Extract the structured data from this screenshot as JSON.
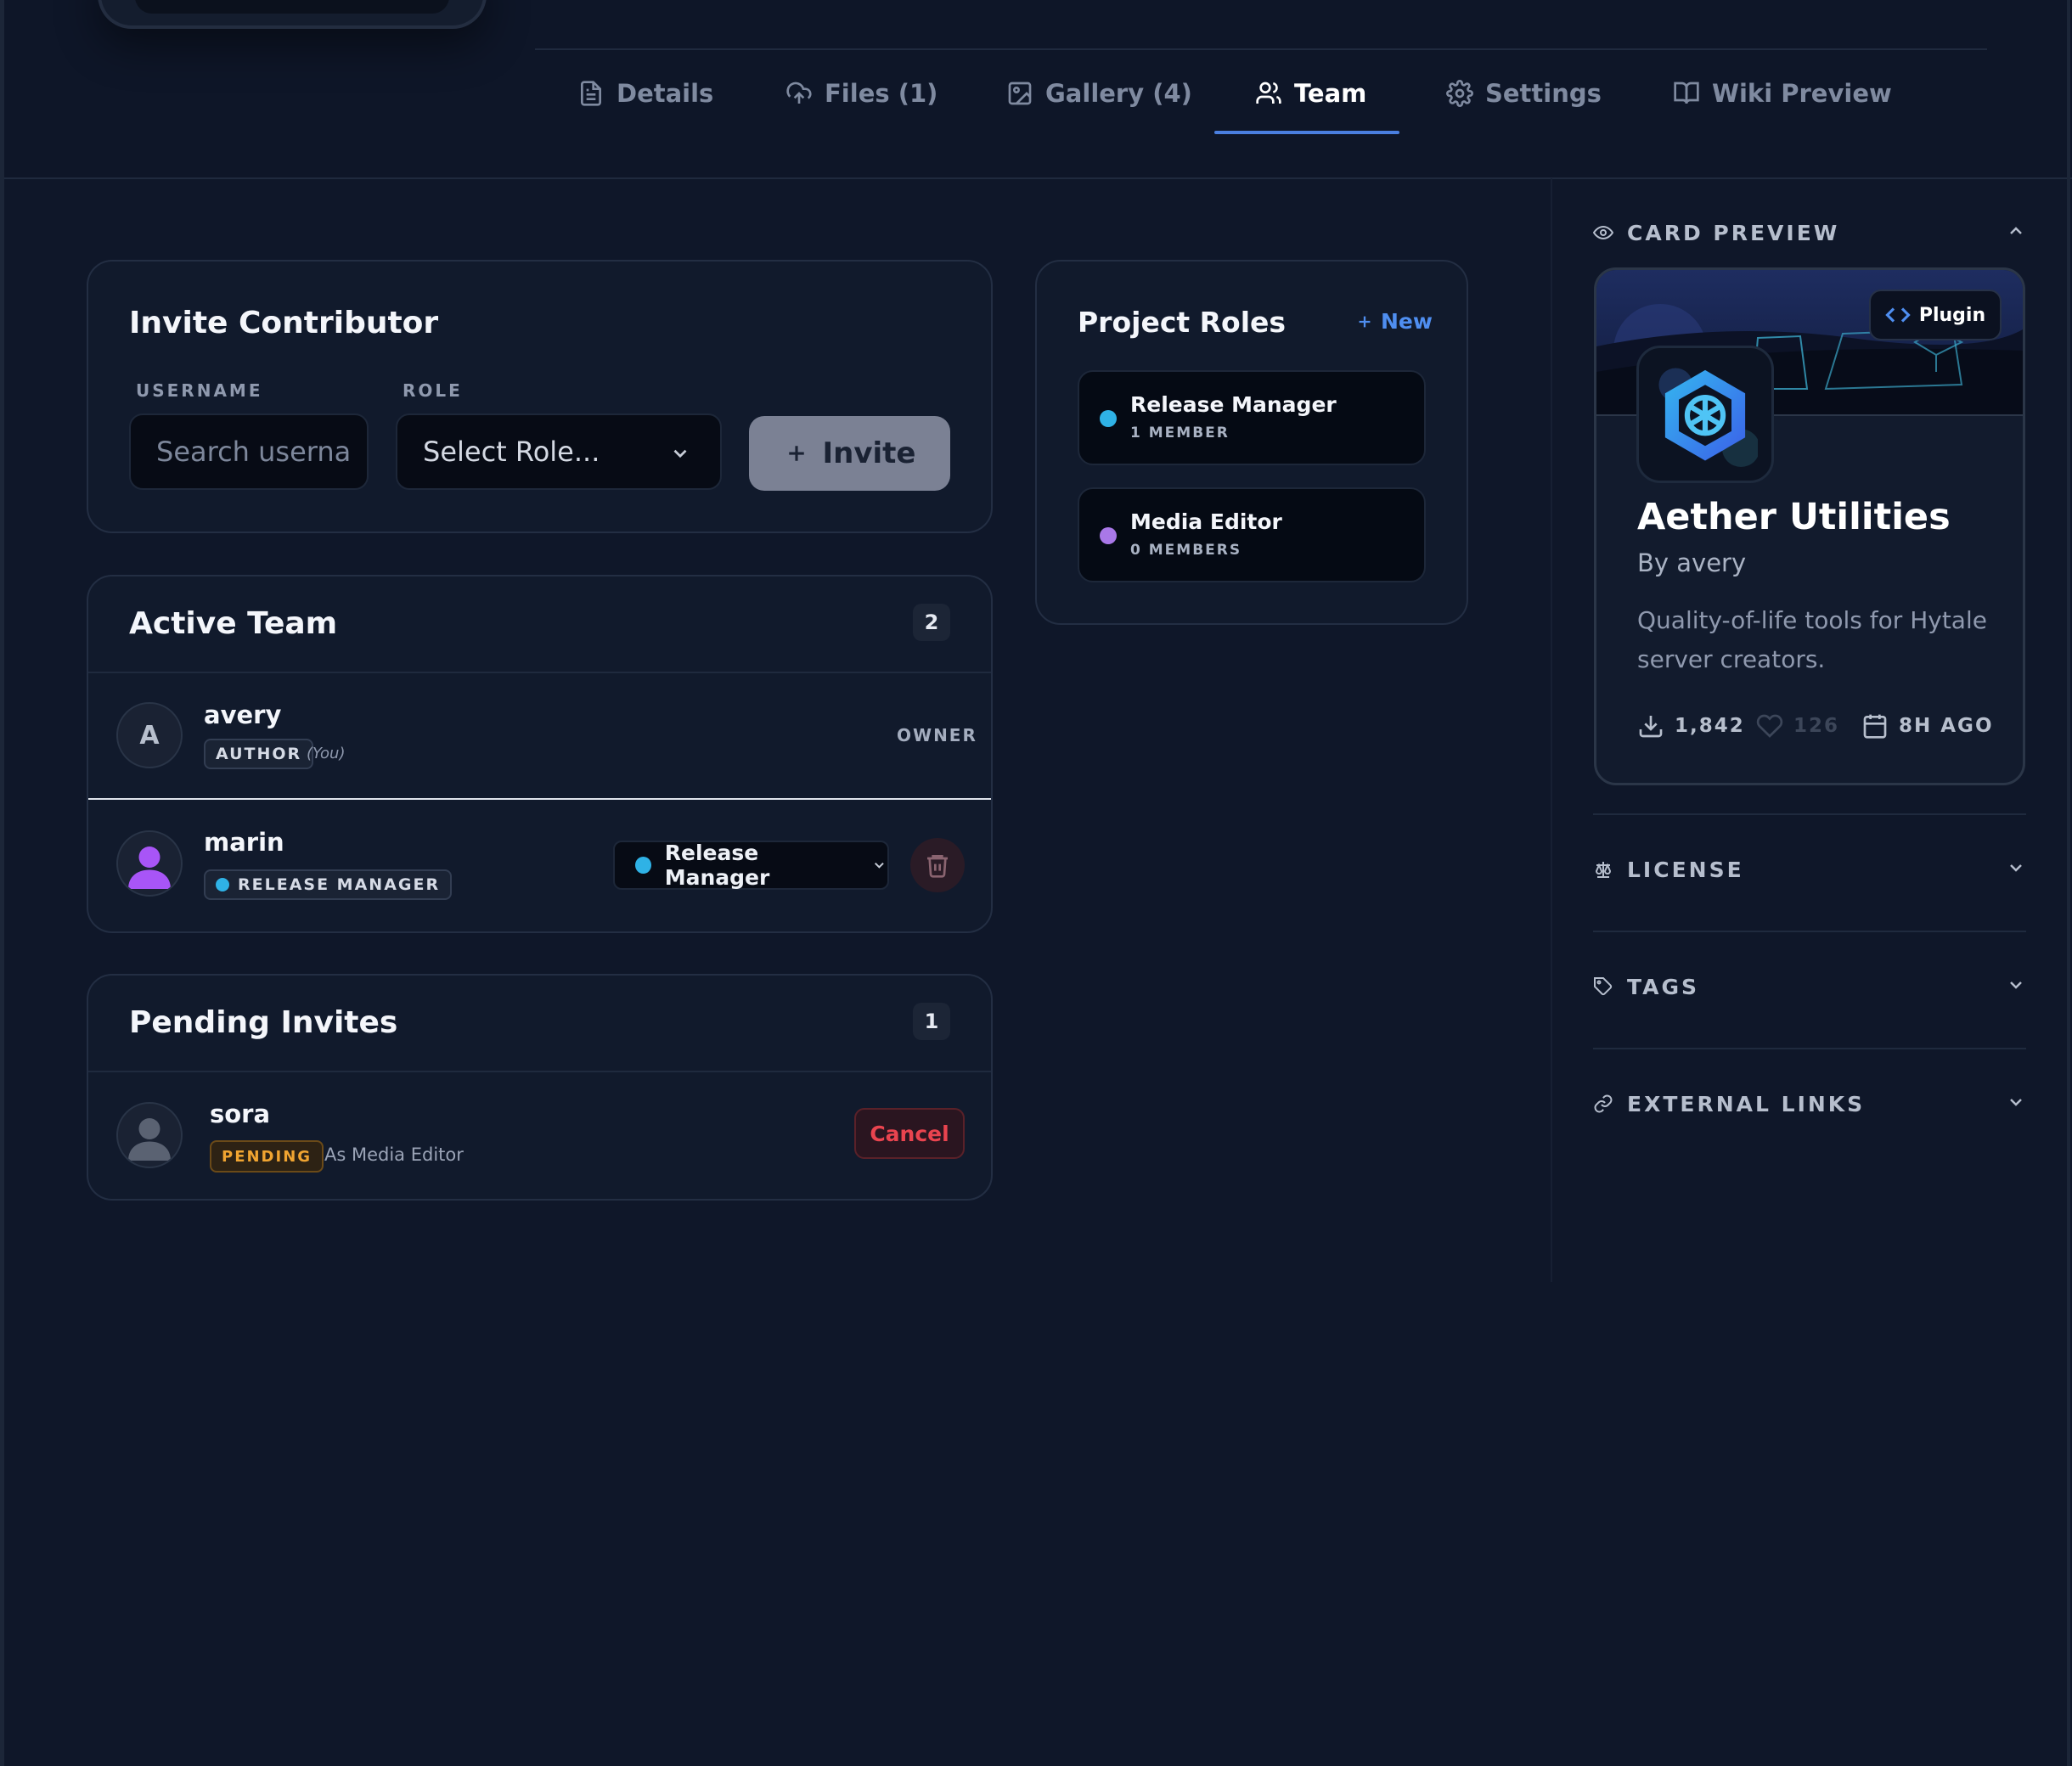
{
  "tabs": [
    {
      "label": "Details",
      "icon": "file-text-icon"
    },
    {
      "label": "Files (1)",
      "icon": "cloud-upload-icon"
    },
    {
      "label": "Gallery (4)",
      "icon": "image-icon"
    },
    {
      "label": "Team",
      "icon": "users-icon",
      "active": true
    },
    {
      "label": "Settings",
      "icon": "gear-icon"
    },
    {
      "label": "Wiki Preview",
      "icon": "book-open-icon"
    }
  ],
  "invite": {
    "title": "Invite Contributor",
    "username_label": "USERNAME",
    "username_placeholder": "Search userna",
    "role_label": "ROLE",
    "role_value": "Select Role...",
    "invite_button": "Invite"
  },
  "active_team": {
    "title": "Active Team",
    "count": "2",
    "members": [
      {
        "initial": "A",
        "name": "avery",
        "role_chip": "AUTHOR",
        "note": "(You)",
        "badge": "OWNER"
      },
      {
        "name": "marin",
        "role_chip": "RELEASE MANAGER",
        "role_select": "Release Manager"
      }
    ]
  },
  "pending": {
    "title": "Pending Invites",
    "count": "1",
    "invites": [
      {
        "name": "sora",
        "status": "PENDING",
        "as_text": "As Media Editor",
        "cancel": "Cancel"
      }
    ]
  },
  "roles": {
    "title": "Project Roles",
    "new_link": "New",
    "items": [
      {
        "name": "Release Manager",
        "count": "1 MEMBER",
        "color": "#2fb2e6"
      },
      {
        "name": "Media Editor",
        "count": "0 MEMBERS",
        "color": "#a978e8"
      }
    ]
  },
  "sidebar": {
    "card_preview": "CARD PREVIEW",
    "license": "LICENSE",
    "tags": "TAGS",
    "external_links": "EXTERNAL LINKS"
  },
  "preview": {
    "type_chip": "Plugin",
    "title": "Aether Utilities",
    "author": "By avery",
    "description": "Quality-of-life tools for Hytale server creators.",
    "downloads": "1,842",
    "likes": "126",
    "updated": "8H AGO"
  },
  "colors": {
    "accent": "#4a7fe0",
    "release_manager": "#2fb2e6",
    "media_editor": "#a978e8",
    "pending": "#f0a431",
    "danger": "#e9444f"
  }
}
